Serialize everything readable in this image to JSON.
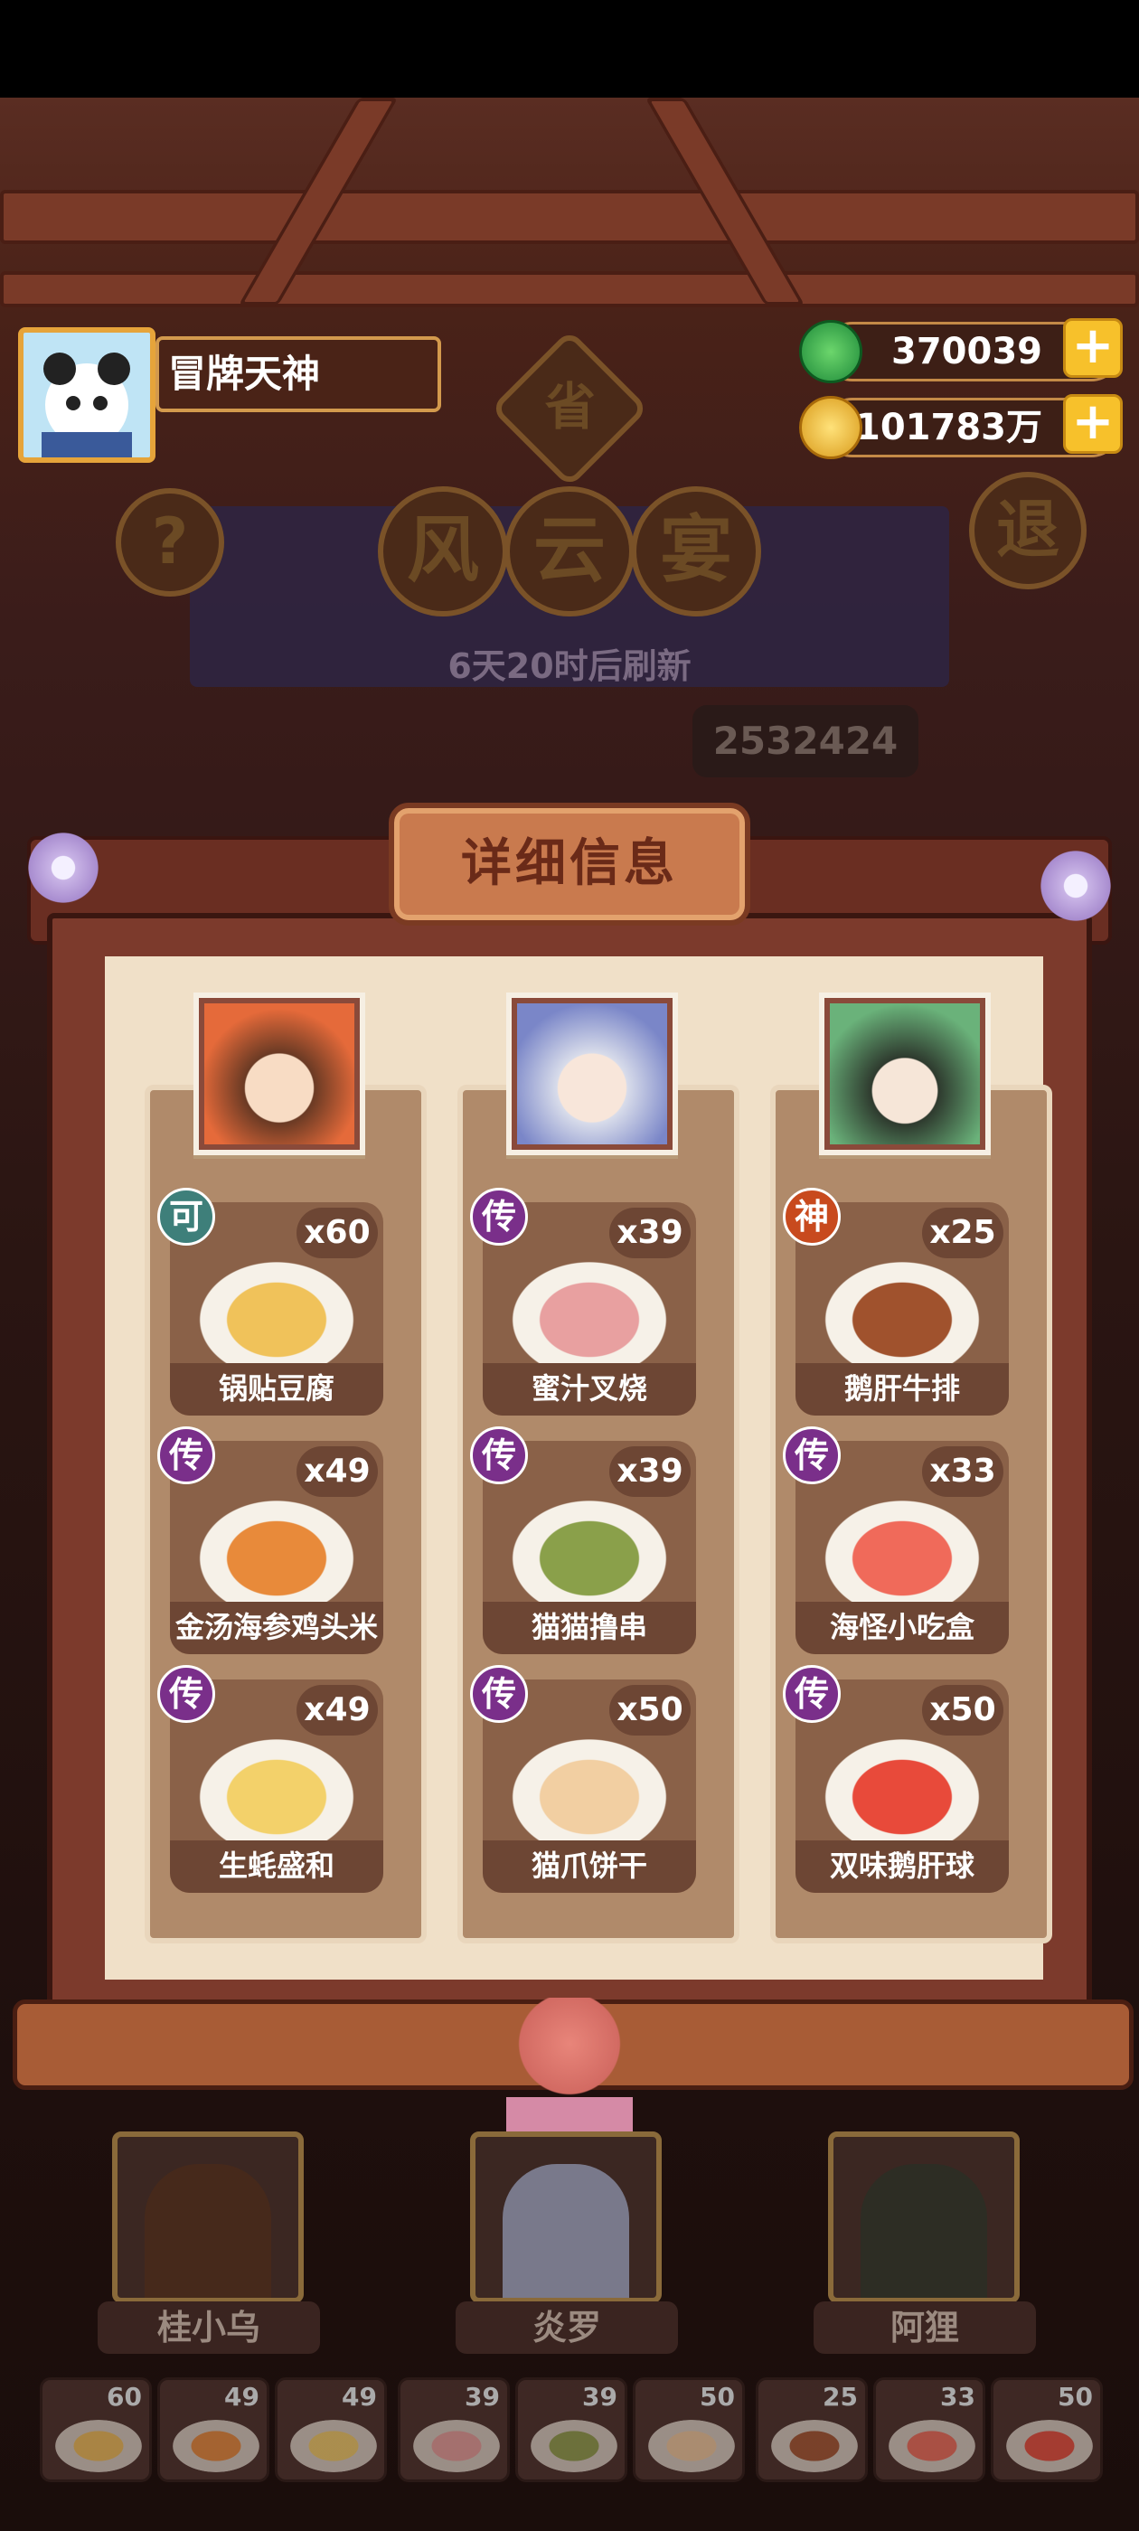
{
  "player": {
    "name": "冒牌天神"
  },
  "resources": {
    "jade": "370039",
    "coins": "101783万"
  },
  "event": {
    "badge": "省",
    "title_chars": [
      "风",
      "云",
      "宴"
    ],
    "help": "?",
    "exit": "退",
    "refresh": "6天20时后刷新",
    "score": "2532424"
  },
  "detail": {
    "title": "详细信息",
    "columns": [
      {
        "dishes": [
          {
            "tier": "可",
            "tier_color": "#3e7f7a",
            "qty": "x60",
            "name": "锅贴豆腐",
            "color": "#f0c25a"
          },
          {
            "tier": "传",
            "tier_color": "#7a2f8a",
            "qty": "x49",
            "name": "金汤海参鸡头米",
            "color": "#e88a3a"
          },
          {
            "tier": "传",
            "tier_color": "#7a2f8a",
            "qty": "x49",
            "name": "生蚝盛和",
            "color": "#f3d16a"
          }
        ]
      },
      {
        "dishes": [
          {
            "tier": "传",
            "tier_color": "#7a2f8a",
            "qty": "x39",
            "name": "蜜汁叉烧",
            "color": "#e8a0a0"
          },
          {
            "tier": "传",
            "tier_color": "#7a2f8a",
            "qty": "x39",
            "name": "猫猫撸串",
            "color": "#8aa04a"
          },
          {
            "tier": "传",
            "tier_color": "#7a2f8a",
            "qty": "x50",
            "name": "猫爪饼干",
            "color": "#f2cfa2"
          }
        ]
      },
      {
        "dishes": [
          {
            "tier": "神",
            "tier_color": "#c84a1e",
            "qty": "x25",
            "name": "鹅肝牛排",
            "color": "#a0522d"
          },
          {
            "tier": "传",
            "tier_color": "#7a2f8a",
            "qty": "x33",
            "name": "海怪小吃盒",
            "color": "#f06a5a"
          },
          {
            "tier": "传",
            "tier_color": "#7a2f8a",
            "qty": "x50",
            "name": "双味鹅肝球",
            "color": "#e84a3a"
          }
        ]
      }
    ]
  },
  "chefs": [
    {
      "name": "桂小乌"
    },
    {
      "name": "炎罗"
    },
    {
      "name": "阿狸"
    }
  ],
  "slots": [
    "60",
    "49",
    "49",
    "39",
    "39",
    "50",
    "25",
    "33",
    "50"
  ]
}
